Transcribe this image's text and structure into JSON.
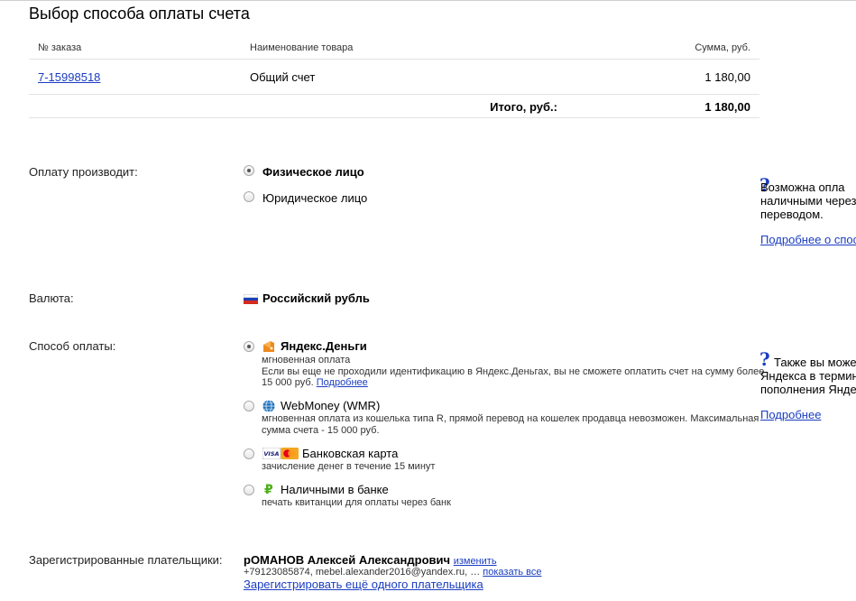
{
  "page": {
    "title": "Выбор способа оплаты счета"
  },
  "order_table": {
    "columns": {
      "order_no": "№ заказа",
      "product": "Наименование товара",
      "amount": "Сумма, руб."
    },
    "rows": [
      {
        "order_no": "7-15998518",
        "product": "Общий счет",
        "amount": "1 180,00"
      }
    ],
    "total_label": "Итого, руб.:",
    "total_value": "1 180,00"
  },
  "payer": {
    "label": "Оплату производит:",
    "options": [
      {
        "label": "Физическое лицо",
        "checked": true
      },
      {
        "label": "Юридическое лицо",
        "checked": false
      }
    ],
    "help_lines": [
      "Возможна опла",
      "наличными через",
      "переводом."
    ],
    "help_link": "Подробнее о спос"
  },
  "currency": {
    "label": "Валюта:",
    "value": "Российский рубль"
  },
  "payment": {
    "label": "Способ оплаты:",
    "options": [
      {
        "name": "Яндекс.Деньги",
        "checked": true,
        "desc1": "мгновенная оплата",
        "desc2": "Если вы еще не проходили идентификацию в Яндекс.Деньгах, вы не сможете оплатить счет на сумму более",
        "desc3": "15 000 руб.",
        "desc_link": "Подробнее"
      },
      {
        "name": "WebMoney (WMR)",
        "checked": false,
        "desc1": "мгновенная оплата из кошелька типа R, прямой перевод на кошелек продавца невозможен. Максимальная",
        "desc2": "сумма счета - 15 000 руб."
      },
      {
        "name": "Банковская карта",
        "checked": false,
        "desc1": "зачисление денег в течение 15 минут"
      },
      {
        "name": "Наличными в банке",
        "checked": false,
        "desc1": "печать квитанции для оплаты через банк"
      }
    ],
    "help_lines": [
      "Также вы може",
      "Яндекса в термин",
      "пополнения Янде"
    ],
    "help_link": "Подробнее"
  },
  "registered": {
    "label": "Зарегистрированные плательщики:",
    "name": "рОМАНОВ Алексей Александрович",
    "change_link": "изменить",
    "contacts": "+79123085874, mebel.alexander2016@yandex.ru, …",
    "show_all_link": "показать все",
    "add_link": "Зарегистрировать ещё одного плательщика"
  },
  "colors": {
    "link": "#1a3dc1",
    "yandex_orange": "#f08a1c",
    "card_visa": "#1a1f71",
    "card_mc": "#eb001b"
  }
}
